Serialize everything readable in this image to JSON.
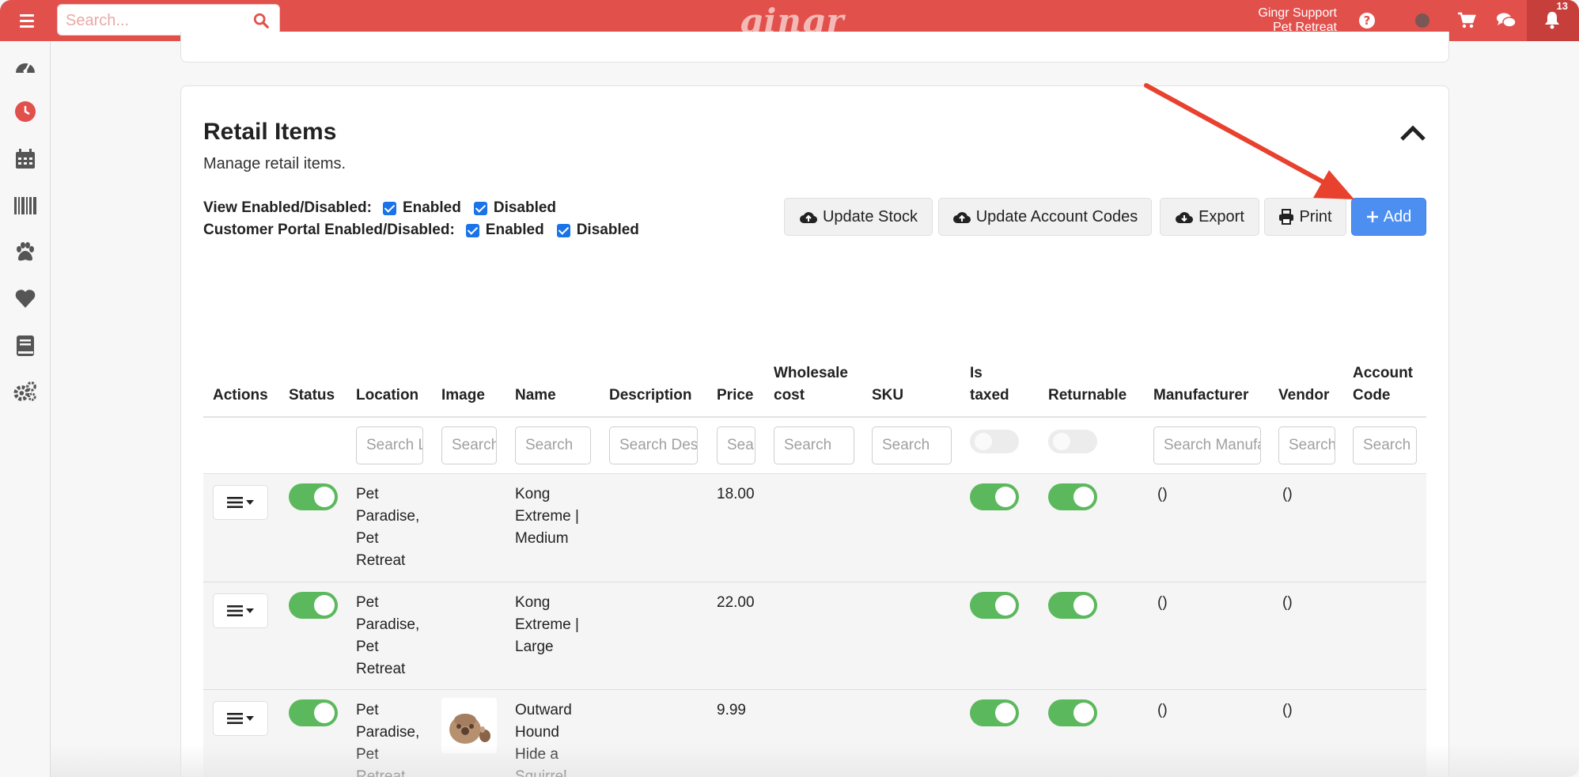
{
  "topbar": {
    "search_placeholder": "Search...",
    "logo": "gingr",
    "user_name": "Gingr Support",
    "location": "Pet Retreat",
    "notification_count": "13",
    "icons": [
      "question-icon",
      "status-dot-icon",
      "cart-icon",
      "chat-icon",
      "bell-icon"
    ]
  },
  "sidebar": {
    "icons": [
      "dashboard-icon",
      "clock-icon",
      "calendar-icon",
      "barcode-icon",
      "paw-icon",
      "heart-icon",
      "book-icon",
      "gears-icon"
    ]
  },
  "section": {
    "title": "Retail Items",
    "subtitle": "Manage retail items.",
    "view_label": "View Enabled/Disabled:",
    "portal_label": "Customer Portal Enabled/Disabled:",
    "enabled": "Enabled",
    "disabled": "Disabled"
  },
  "toolbar": {
    "update_stock": "Update Stock",
    "update_account_codes": "Update Account Codes",
    "export": "Export",
    "print": "Print",
    "add": "Add"
  },
  "table": {
    "headers": {
      "actions": "Actions",
      "status": "Status",
      "location": "Location",
      "image": "Image",
      "name": "Name",
      "description": "Description",
      "price": "Price",
      "wholesale_1": "Wholesale",
      "wholesale_2": "cost",
      "sku": "SKU",
      "taxed_1": "Is",
      "taxed_2": "taxed",
      "returnable": "Returnable",
      "manufacturer": "Manufacturer",
      "vendor": "Vendor",
      "account_1": "Account",
      "account_2": "Code"
    },
    "placeholders": {
      "location": "Search Location",
      "image": "Search",
      "name": "Search",
      "description": "Search Description",
      "price": "Search",
      "wholesale": "Search",
      "sku": "Search",
      "manufacturer": "Search Manufacturer",
      "vendor": "Search",
      "account": "Search"
    },
    "rows": [
      {
        "location": [
          "Pet",
          "Paradise,",
          "Pet",
          "Retreat"
        ],
        "name": [
          "Kong",
          "Extreme |",
          "Medium"
        ],
        "price": "18.00",
        "manufacturer": "()",
        "vendor": "()"
      },
      {
        "location": [
          "Pet",
          "Paradise,",
          "Pet",
          "Retreat"
        ],
        "name": [
          "Kong",
          "Extreme |",
          "Large"
        ],
        "price": "22.00",
        "manufacturer": "()",
        "vendor": "()"
      },
      {
        "location": [
          "Pet",
          "Paradise,",
          "Pet",
          "Retreat"
        ],
        "name": [
          "Outward",
          "Hound",
          "Hide a",
          "Squirrel"
        ],
        "price": "9.99",
        "manufacturer": "()",
        "vendor": "()"
      }
    ]
  },
  "colors": {
    "brand": "#e2504c",
    "primary_button": "#4d8ff0",
    "toggle_on": "#5cb85c",
    "annotation_arrow": "#e8412e"
  }
}
